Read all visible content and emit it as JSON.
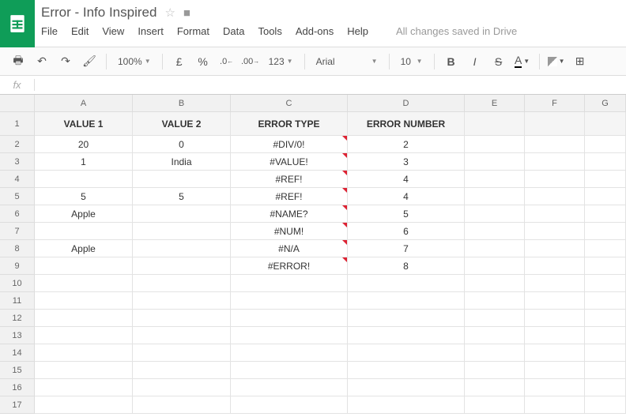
{
  "doc": {
    "title": "Error - Info Inspired",
    "save_status": "All changes saved in Drive"
  },
  "menu": {
    "file": "File",
    "edit": "Edit",
    "view": "View",
    "insert": "Insert",
    "format": "Format",
    "data": "Data",
    "tools": "Tools",
    "addons": "Add-ons",
    "help": "Help"
  },
  "toolbar": {
    "zoom": "100%",
    "currency": "£",
    "percent": "%",
    "dec_less": ".0",
    "dec_more": ".00",
    "num_fmt": "123",
    "font": "Arial",
    "size": "10",
    "bold": "B",
    "italic": "I",
    "strike": "S",
    "text_color": "A"
  },
  "fx": {
    "label": "fx"
  },
  "columns": [
    "A",
    "B",
    "C",
    "D",
    "E",
    "F",
    "G"
  ],
  "header_row": [
    "VALUE 1",
    "VALUE 2",
    "ERROR TYPE",
    "ERROR NUMBER",
    "",
    "",
    ""
  ],
  "rows": [
    {
      "n": "2",
      "a": "20",
      "b": "0",
      "c": "#DIV/0!",
      "d": "2",
      "err": true
    },
    {
      "n": "3",
      "a": "1",
      "b": "India",
      "c": "#VALUE!",
      "d": "3",
      "err": true
    },
    {
      "n": "4",
      "a": "",
      "b": "",
      "c": "#REF!",
      "d": "4",
      "err": true
    },
    {
      "n": "5",
      "a": "5",
      "b": "5",
      "c": "#REF!",
      "d": "4",
      "err": true
    },
    {
      "n": "6",
      "a": "Apple",
      "b": "",
      "c": "#NAME?",
      "d": "5",
      "err": true
    },
    {
      "n": "7",
      "a": "",
      "b": "",
      "c": "#NUM!",
      "d": "6",
      "err": true
    },
    {
      "n": "8",
      "a": "Apple",
      "b": "",
      "c": "#N/A",
      "d": "7",
      "err": true
    },
    {
      "n": "9",
      "a": "",
      "b": "",
      "c": "#ERROR!",
      "d": "8",
      "err": true
    },
    {
      "n": "10",
      "a": "",
      "b": "",
      "c": "",
      "d": "",
      "err": false
    },
    {
      "n": "11",
      "a": "",
      "b": "",
      "c": "",
      "d": "",
      "err": false
    },
    {
      "n": "12",
      "a": "",
      "b": "",
      "c": "",
      "d": "",
      "err": false
    },
    {
      "n": "13",
      "a": "",
      "b": "",
      "c": "",
      "d": "",
      "err": false
    },
    {
      "n": "14",
      "a": "",
      "b": "",
      "c": "",
      "d": "",
      "err": false
    },
    {
      "n": "15",
      "a": "",
      "b": "",
      "c": "",
      "d": "",
      "err": false
    },
    {
      "n": "16",
      "a": "",
      "b": "",
      "c": "",
      "d": "",
      "err": false
    },
    {
      "n": "17",
      "a": "",
      "b": "",
      "c": "",
      "d": "",
      "err": false
    }
  ]
}
